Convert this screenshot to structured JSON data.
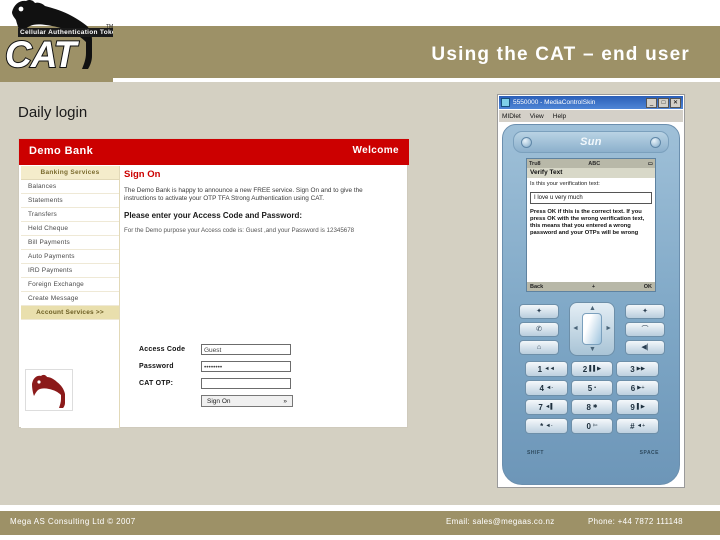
{
  "slide": {
    "title": "Using the CAT – end user",
    "section_heading": "Daily login",
    "band_color": "#9d9167",
    "page_bg": "#d4d0c2"
  },
  "logo": {
    "wordmark": "CAT",
    "tagline": "Cellular Authentication Token",
    "tm": "TM"
  },
  "bank": {
    "name": "Demo Bank",
    "welcome": "Welcome",
    "header_color": "#cc0000",
    "nav_header": "Banking Services",
    "nav_items": [
      "Balances",
      "Statements",
      "Transfers",
      "Held Cheque",
      "Bill Payments",
      "Auto Payments",
      "IRD Payments",
      "Foreign Exchange",
      "Create Message"
    ],
    "nav_highlight": "Account Services   >>",
    "signon_heading": "Sign On",
    "intro_text": "The Demo Bank is happy to announce a new FREE service. Sign On and to give the instructions to activate your OTP TFA Strong Authentication using CAT.",
    "enter_prompt": "Please enter your Access Code and Password:",
    "demo_note": "For the Demo purpose your Access code is: Guest ,and your Password is 12345678",
    "form": {
      "access_code_label": "Access Code",
      "access_code_value": "Guest",
      "password_label": "Password",
      "password_value": "••••••••",
      "otp_label": "CAT OTP:",
      "otp_value": "",
      "submit_label": "Sign On",
      "submit_arrow": "»"
    }
  },
  "emulator": {
    "window_title": "5550000 - MediaControlSkin",
    "window_buttons": [
      "_",
      "□",
      "✕"
    ],
    "menus": [
      "MIDlet",
      "View",
      "Help"
    ],
    "brand": "Sun",
    "screen": {
      "status_left": "Tru8",
      "status_mid": "ABC",
      "status_right": "▭",
      "title": "Verify Text",
      "prompt": "Is this your verification text:",
      "verify_value": "I love u very much",
      "instruction": "Press OK if this is the correct text. If you press OK with the wrong verification text, this means that you entered a wrong password and your OTPs will be wrong",
      "softkey_left": "Back",
      "softkey_right": "OK"
    },
    "keypad": [
      {
        "digit": "1",
        "sub": "◄◄"
      },
      {
        "digit": "2",
        "sub": "▌▌▶"
      },
      {
        "digit": "3",
        "sub": "▶▶"
      },
      {
        "digit": "4",
        "sub": "◄-"
      },
      {
        "digit": "5",
        "sub": "▪"
      },
      {
        "digit": "6",
        "sub": "▶+"
      },
      {
        "digit": "7",
        "sub": "◄▌"
      },
      {
        "digit": "8",
        "sub": "✱"
      },
      {
        "digit": "9",
        "sub": "▌▶"
      },
      {
        "digit": "*",
        "sub": "◄-"
      },
      {
        "digit": "0",
        "sub": "✄"
      },
      {
        "digit": "#",
        "sub": "◄+"
      }
    ],
    "bottom_labels": {
      "shift": "SHIFT",
      "space": "SPACE"
    }
  },
  "footer": {
    "company": "Mega AS Consulting Ltd  ©  2007",
    "email": "Email: sales@megaas.co.nz",
    "phone": "Phone: +44 7872 111148"
  }
}
